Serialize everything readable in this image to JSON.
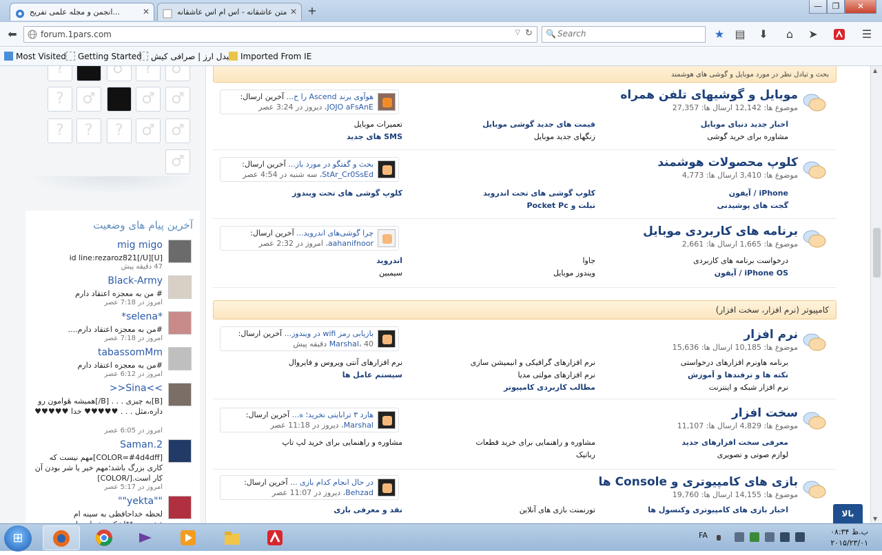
{
  "browser": {
    "tabs": [
      {
        "title": "انجمن و مجله علمی تفریح...",
        "active": true
      },
      {
        "title": "متن عاشقانه - اس ام اس عاشقانه",
        "active": false
      }
    ],
    "new_tab": "+",
    "window_controls": {
      "minimize": "—",
      "restore": "❐",
      "close": "✕"
    },
    "url": "forum.1pars.com",
    "search_placeholder": "Search",
    "bookmarks": [
      "Most Visited",
      "Getting Started",
      "مبدل ارز | صرافی کیش",
      "Imported From IE"
    ]
  },
  "sidebar": {
    "status_heading": "آخرین پیام های وضعیت",
    "statuses": [
      {
        "name": "mig migo",
        "text": "[U]id line:rezaroz821[/U]",
        "time": "47 دقیقه پیش"
      },
      {
        "name": "Black-Army",
        "text": "# من به معجزه اعتقاد دارم",
        "time": "امروز در 7:18 عصر"
      },
      {
        "name": "*selena*",
        "text": "#من به معجزه اعتقاد دارم....",
        "time": "امروز در 7:18 عصر"
      },
      {
        "name": "tabassomMm",
        "text": "#من به معجزه اعتقاد دارم",
        "time": "امروز در 6:12 عصر"
      },
      {
        "name": ">>Sina<<",
        "text": "[B]به چیزی . . . [B/]همیشه هَوامون رو داره،مثل . . . ♥♥♥♥♥ خدا ♥♥♥♥♥",
        "time": "امروز در 6:05 عصر"
      },
      {
        "name": "Saman.2",
        "text": "[COLOR=#4d4dff]مهم نیست که کاری بزرگ باشد؛مهم خیر یا شر بودن آن کار است.[/COLOR]",
        "time": "امروز در 5:17 عصر"
      },
      {
        "name": "\"\"yekta\"\"",
        "text": "لحظه خداحافظی به سینه ام فشردمت**اشک چشمام جاری",
        "time": ""
      }
    ]
  },
  "main": {
    "top_cat_desc": "بحث و تبادل نظر در مورد موبایل و گوشی های هوشمند",
    "cat2_title": "کامپیوتر (نرم افزار، سخت افزار)",
    "forums": [
      {
        "title": "موبایل و گوشیهای تلفن همراه",
        "stats": "موضوع ها: 12,142 ارسال ها: 27,357",
        "subs": [
          {
            "t": "اخبار جدید دنیای موبایل",
            "b": true
          },
          {
            "t": "قیمت های جدید گوشی موبایل",
            "b": true
          },
          {
            "t": "تعمیرات موبایل",
            "b": false
          },
          {
            "t": "مشاوره برای خرید گوشی",
            "b": false
          },
          {
            "t": "زنگهای جدید موبایل",
            "b": false
          },
          {
            "t": "SMS های جدید",
            "b": true
          }
        ],
        "last": {
          "label": "آخرین ارسال:",
          "topic": "هوآوی برند Ascend را ح...",
          "user": "JOJO aFsAnE",
          "time": "، دیروز در 3:24 عصر"
        },
        "rss_on": true
      },
      {
        "title": "کلوپ محصولات هوشمند",
        "stats": "موضوع ها: 3,410 ارسال ها: 4,773",
        "subs": [
          {
            "t": "iPhone / آیفون",
            "b": true
          },
          {
            "t": "کلوپ گوشی های تحت اندروید",
            "b": true
          },
          {
            "t": "کلوپ گوشی های تحت ویندوز",
            "b": true
          },
          {
            "t": "گجت های پوشیدنی",
            "b": true
          },
          {
            "t": "تبلت و Pocket Pc",
            "b": true
          }
        ],
        "last": {
          "label": "آخرین ارسال:",
          "topic": "بحث و گفتگو در مورد باز...",
          "user": "StAr_Cr0SsEd",
          "time": "، سه شنبه در 4:54 عصر"
        },
        "rss_on": false
      },
      {
        "title": "برنامه های کاربردی موبایل",
        "stats": "موضوع ها: 1,665 ارسال ها: 2,661",
        "subs": [
          {
            "t": "درخواست برنامه های کاربردی",
            "b": false
          },
          {
            "t": "جاوا",
            "b": false
          },
          {
            "t": "اندروید",
            "b": true
          },
          {
            "t": "iPhone OS / آیفون",
            "b": true
          },
          {
            "t": "ویندوز موبایل",
            "b": false
          },
          {
            "t": "سیمبین",
            "b": false
          }
        ],
        "last": {
          "label": "آخرین ارسال:",
          "topic": "چرا گوشی‌های اندروید...",
          "user": "aahanifnoor",
          "time": "، امروز در 2:32 عصر"
        },
        "rss_on": false
      },
      {
        "title": "نرم افزار",
        "stats": "موضوع ها: 10,185 ارسال ها: 15,636",
        "subs": [
          {
            "t": "برنامه هاونرم افزارهای درخواستی",
            "b": false
          },
          {
            "t": "نرم افزارهای گرافیکی و انیمیشن سازی",
            "b": false
          },
          {
            "t": "نرم افزارهای آنتی ویروس و فایروال",
            "b": false
          },
          {
            "t": "نکته ها و ترفندها و آموزش",
            "b": true
          },
          {
            "t": "نرم افزارهای مولتی مدیا",
            "b": false
          },
          {
            "t": "سیستم عامل ها",
            "b": true
          },
          {
            "t": "نرم افزار شبکه و اینترنت",
            "b": false
          },
          {
            "t": "مطالب کاربردی کامپیوتر",
            "b": true
          }
        ],
        "last": {
          "label": "آخرین ارسال:",
          "topic": "بازیابی رمز wifi در ویندوز...",
          "user": "Marshal",
          "time": "، 40 دقیقه پیش"
        },
        "rss_on": false
      },
      {
        "title": "سخت افزار",
        "stats": "موضوع ها: 4,829 ارسال ها: 11,107",
        "subs": [
          {
            "t": "معرفی سخت افزارهای جدید",
            "b": true
          },
          {
            "t": "مشاوره و راهنمایی برای خرید قطعات",
            "b": false
          },
          {
            "t": "مشاوره و راهنمایی برای خرید لپ تاپ",
            "b": false
          },
          {
            "t": "لوازم صوتی و تصویری",
            "b": false
          },
          {
            "t": "رباتیک",
            "b": false
          }
        ],
        "last": {
          "label": "آخرین ارسال:",
          "topic": "هارد ۳ ترابایتی نخرید؛ ه...",
          "user": "Marshal",
          "time": "، دیروز در 11:18 عصر"
        },
        "rss_on": false
      },
      {
        "title": "بازی های کامپیوتری و Console ها",
        "stats": "موضوع ها: 14,155 ارسال ها: 19,760",
        "subs": [
          {
            "t": "اخبار بازی های کامپیوتری وکنسول ها",
            "b": true
          },
          {
            "t": "تورنمنت بازی های آنلاین",
            "b": false
          },
          {
            "t": "نقد و معرفی بازی",
            "b": true
          }
        ],
        "last": {
          "label": "آخرین ارسال:",
          "topic": "در حال انجام کدام بازی ...",
          "user": "Behzad",
          "time": "، دیروز در 11:07 عصر"
        },
        "rss_on": false
      }
    ]
  },
  "scroll_top_label": "بالا",
  "taskbar": {
    "lang": "FA",
    "clock_time": "ب.ظ ۰۸:۳۴",
    "clock_date": "۲۰۱۵/۲۳/۰۱"
  },
  "colors": {
    "link_blue": "#1c3f79",
    "cat_orange": "#fce6c0",
    "top_btn": "#1f4f8e"
  }
}
